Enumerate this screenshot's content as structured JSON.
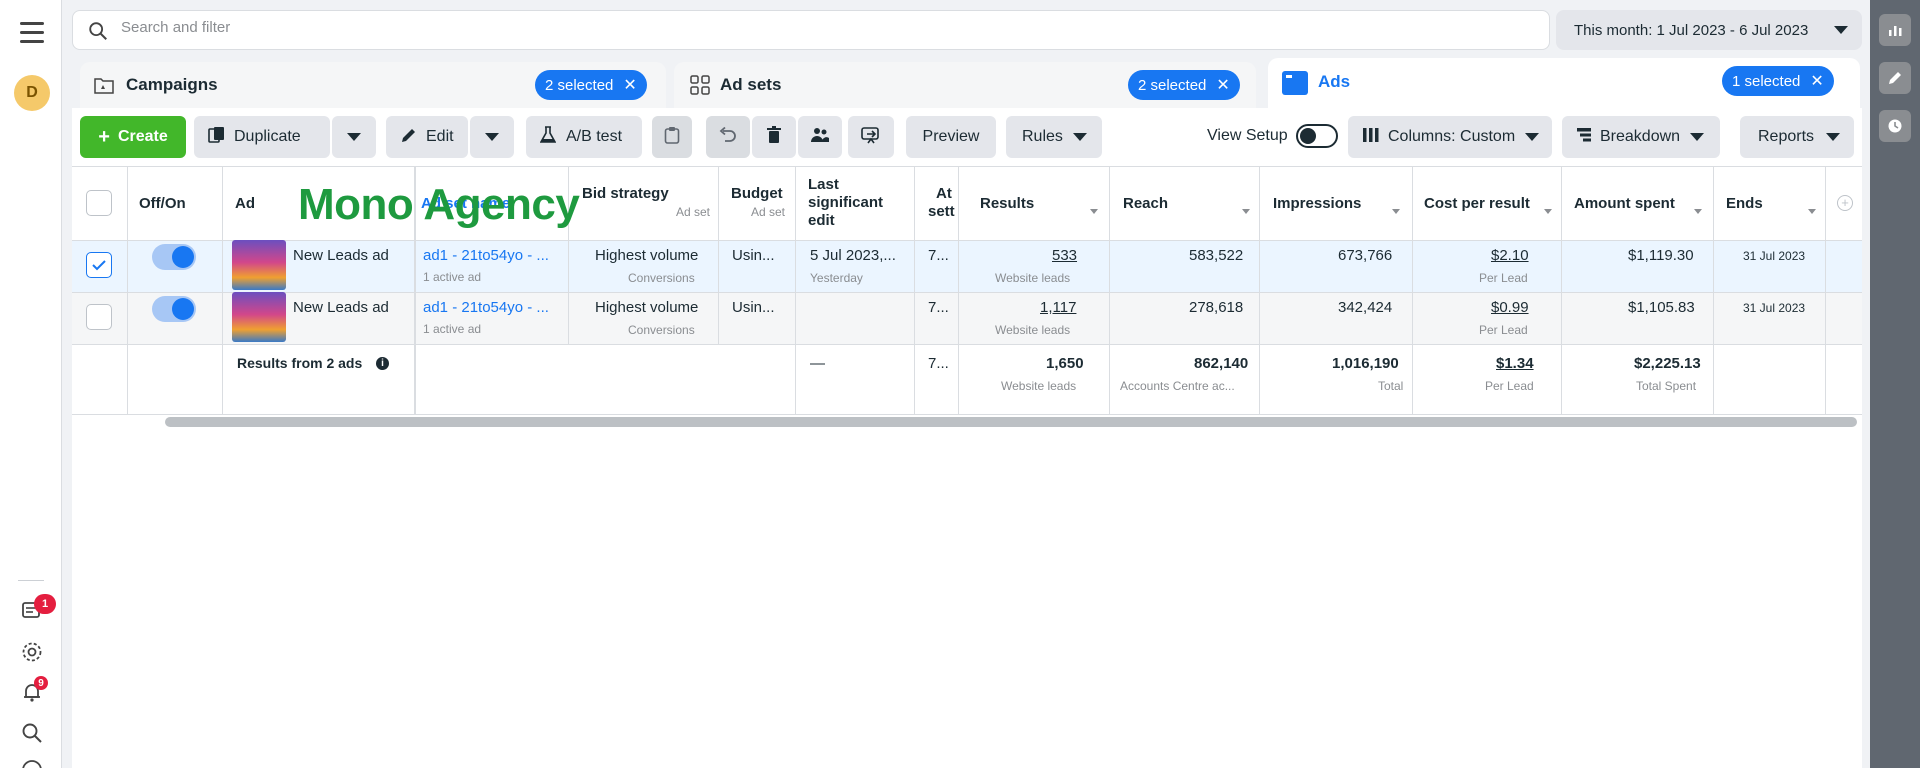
{
  "nav": {
    "avatar_letter": "D",
    "notif_badge_1": "1",
    "notif_badge_2": "9"
  },
  "search": {
    "placeholder": "Search and filter"
  },
  "date_range": "This month: 1 Jul 2023 - 6 Jul 2023",
  "tabs": [
    {
      "label": "Campaigns",
      "selected": "2 selected"
    },
    {
      "label": "Ad sets",
      "selected": "2 selected"
    },
    {
      "label": "Ads",
      "selected": "1 selected"
    }
  ],
  "toolbar": {
    "create": "Create",
    "duplicate": "Duplicate",
    "edit": "Edit",
    "ab_test": "A/B test",
    "preview": "Preview",
    "rules": "Rules",
    "view_setup": "View Setup",
    "columns": "Columns: Custom",
    "breakdown": "Breakdown",
    "reports": "Reports"
  },
  "columns": {
    "off_on": "Off/On",
    "ad": "Ad",
    "ad_set_name": "Ad set name",
    "bid_strategy": "Bid strategy",
    "bid_strategy_sub": "Ad set",
    "budget": "Budget",
    "budget_sub": "Ad set",
    "last_edit_1": "Last",
    "last_edit_2": "significant",
    "last_edit_3": "edit",
    "attr_1": "At",
    "attr_2": "sett",
    "results": "Results",
    "reach": "Reach",
    "impressions": "Impressions",
    "cost_per_result": "Cost per result",
    "amount_spent": "Amount spent",
    "ends": "Ends"
  },
  "rows": [
    {
      "ad": "New Leads ad",
      "ad_set": "ad1 - 21to54yo - ...",
      "ad_set_sub": "1 active ad",
      "bid": "Highest volume",
      "bid_sub": "Conversions",
      "budget": "Usin...",
      "last_edit": "5 Jul 2023,...",
      "last_edit_sub": "Yesterday",
      "attr": "7...",
      "results": "533",
      "results_sub": "Website leads",
      "reach": "583,522",
      "impressions": "673,766",
      "cpr": "$2.10",
      "cpr_sub": "Per Lead",
      "spent": "$1,119.30",
      "ends": "31 Jul 2023"
    },
    {
      "ad": "New Leads ad",
      "ad_set": "ad1 - 21to54yo - ...",
      "ad_set_sub": "1 active ad",
      "bid": "Highest volume",
      "bid_sub": "Conversions",
      "budget": "Usin...",
      "last_edit": "",
      "last_edit_sub": "",
      "attr": "7...",
      "results": "1,117",
      "results_sub": "Website leads",
      "reach": "278,618",
      "impressions": "342,424",
      "cpr": "$0.99",
      "cpr_sub": "Per Lead",
      "spent": "$1,105.83",
      "ends": "31 Jul 2023"
    }
  ],
  "totals": {
    "label": "Results from 2 ads",
    "last_edit": "—",
    "attr": "7...",
    "results": "1,650",
    "results_sub": "Website leads",
    "reach": "862,140",
    "reach_sub": "Accounts Centre ac...",
    "impressions": "1,016,190",
    "impressions_sub": "Total",
    "cpr": "$1.34",
    "cpr_sub": "Per Lead",
    "spent": "$2,225.13",
    "spent_sub": "Total Spent"
  },
  "watermark": "Mono Agency",
  "colors": {
    "accent": "#1877f2",
    "create": "#42b72a",
    "badge": "#e41e3f",
    "watermark": "#1e9a3f"
  }
}
